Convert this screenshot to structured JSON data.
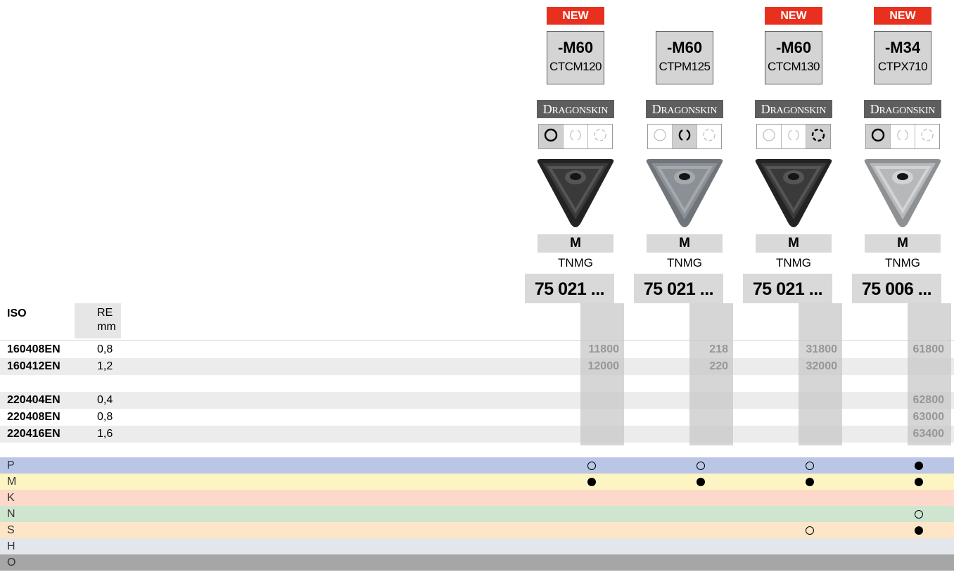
{
  "products": [
    {
      "badge": "NEW",
      "geometry": "-M60",
      "grade": "CTCM120",
      "coating": "DRAGONSKIN",
      "active_condition": 0,
      "insert_color": "dark",
      "group": "M",
      "insert_type": "TNMG",
      "article": "75 021 ..."
    },
    {
      "badge": "",
      "geometry": "-M60",
      "grade": "CTPM125",
      "coating": "DRAGONSKIN",
      "active_condition": 1,
      "insert_color": "grey",
      "group": "M",
      "insert_type": "TNMG",
      "article": "75 021 ..."
    },
    {
      "badge": "NEW",
      "geometry": "-M60",
      "grade": "CTCM130",
      "coating": "DRAGONSKIN",
      "active_condition": 2,
      "insert_color": "dark",
      "group": "M",
      "insert_type": "TNMG",
      "article": "75 021 ..."
    },
    {
      "badge": "NEW",
      "geometry": "-M34",
      "grade": "CTPX710",
      "coating": "DRAGONSKIN",
      "active_condition": 0,
      "insert_color": "light",
      "group": "M",
      "insert_type": "TNMG",
      "article": "75 006 ..."
    }
  ],
  "table": {
    "iso_header": "ISO",
    "re_header": "RE",
    "re_unit": "mm",
    "rows": [
      {
        "iso": "160408EN",
        "re": "0,8",
        "codes": [
          "11800",
          "218",
          "31800",
          "61800"
        ]
      },
      {
        "iso": "160412EN",
        "re": "1,2",
        "codes": [
          "12000",
          "220",
          "32000",
          ""
        ]
      },
      {
        "iso": "",
        "re": "",
        "codes": [
          "",
          "",
          "",
          ""
        ]
      },
      {
        "iso": "220404EN",
        "re": "0,4",
        "codes": [
          "",
          "",
          "",
          "62800"
        ]
      },
      {
        "iso": "220408EN",
        "re": "0,8",
        "codes": [
          "",
          "",
          "",
          "63000"
        ]
      },
      {
        "iso": "220416EN",
        "re": "1,6",
        "codes": [
          "",
          "",
          "",
          "63400"
        ]
      }
    ]
  },
  "materials": [
    {
      "label": "P",
      "color": "#b9c6e6",
      "marks": [
        "empty",
        "empty",
        "empty",
        "full"
      ]
    },
    {
      "label": "M",
      "color": "#fdf4c4",
      "marks": [
        "full",
        "full",
        "full",
        "full"
      ]
    },
    {
      "label": "K",
      "color": "#fcd9cb",
      "marks": [
        "",
        "",
        "",
        ""
      ]
    },
    {
      "label": "N",
      "color": "#cfe5cf",
      "marks": [
        "",
        "",
        "",
        "empty"
      ]
    },
    {
      "label": "S",
      "color": "#fde6c8",
      "marks": [
        "",
        "",
        "empty",
        "full"
      ]
    },
    {
      "label": "H",
      "color": "#e3e6ea",
      "marks": [
        "",
        "",
        "",
        ""
      ]
    },
    {
      "label": "O",
      "color": "#a6a6a6",
      "marks": [
        "",
        "",
        "",
        ""
      ]
    }
  ]
}
